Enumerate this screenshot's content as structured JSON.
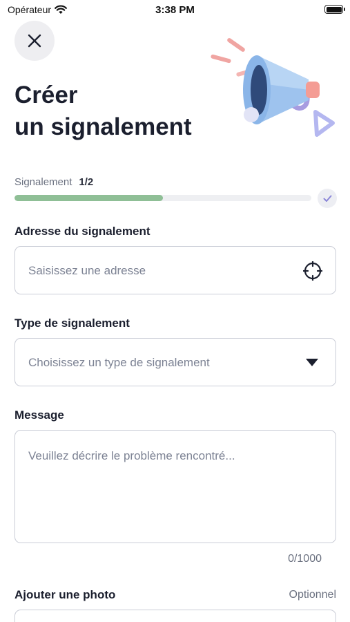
{
  "status_bar": {
    "carrier": "Opérateur",
    "time": "3:38 PM"
  },
  "header": {
    "title_line1": "Créer",
    "title_line2": "un signalement"
  },
  "progress": {
    "label": "Signalement",
    "step": "1/2",
    "fraction": 0.5
  },
  "form": {
    "address": {
      "label": "Adresse du signalement",
      "placeholder": "Saisissez une adresse"
    },
    "type": {
      "label": "Type de signalement",
      "placeholder": "Choisissez un type de signalement"
    },
    "message": {
      "label": "Message",
      "placeholder": "Veuillez décrire le problème rencontré...",
      "counter": "0/1000"
    },
    "photo": {
      "label": "Ajouter une photo",
      "optional": "Optionnel"
    }
  },
  "colors": {
    "progress_fill": "#8fbf96",
    "progress_track": "#eeeff2",
    "accent_purple": "#8b86d8"
  },
  "icons": {
    "close": "close-icon",
    "locate": "crosshair-icon",
    "dropdown": "caret-down-icon",
    "check": "check-icon",
    "wifi": "wifi-icon",
    "battery": "battery-icon"
  }
}
